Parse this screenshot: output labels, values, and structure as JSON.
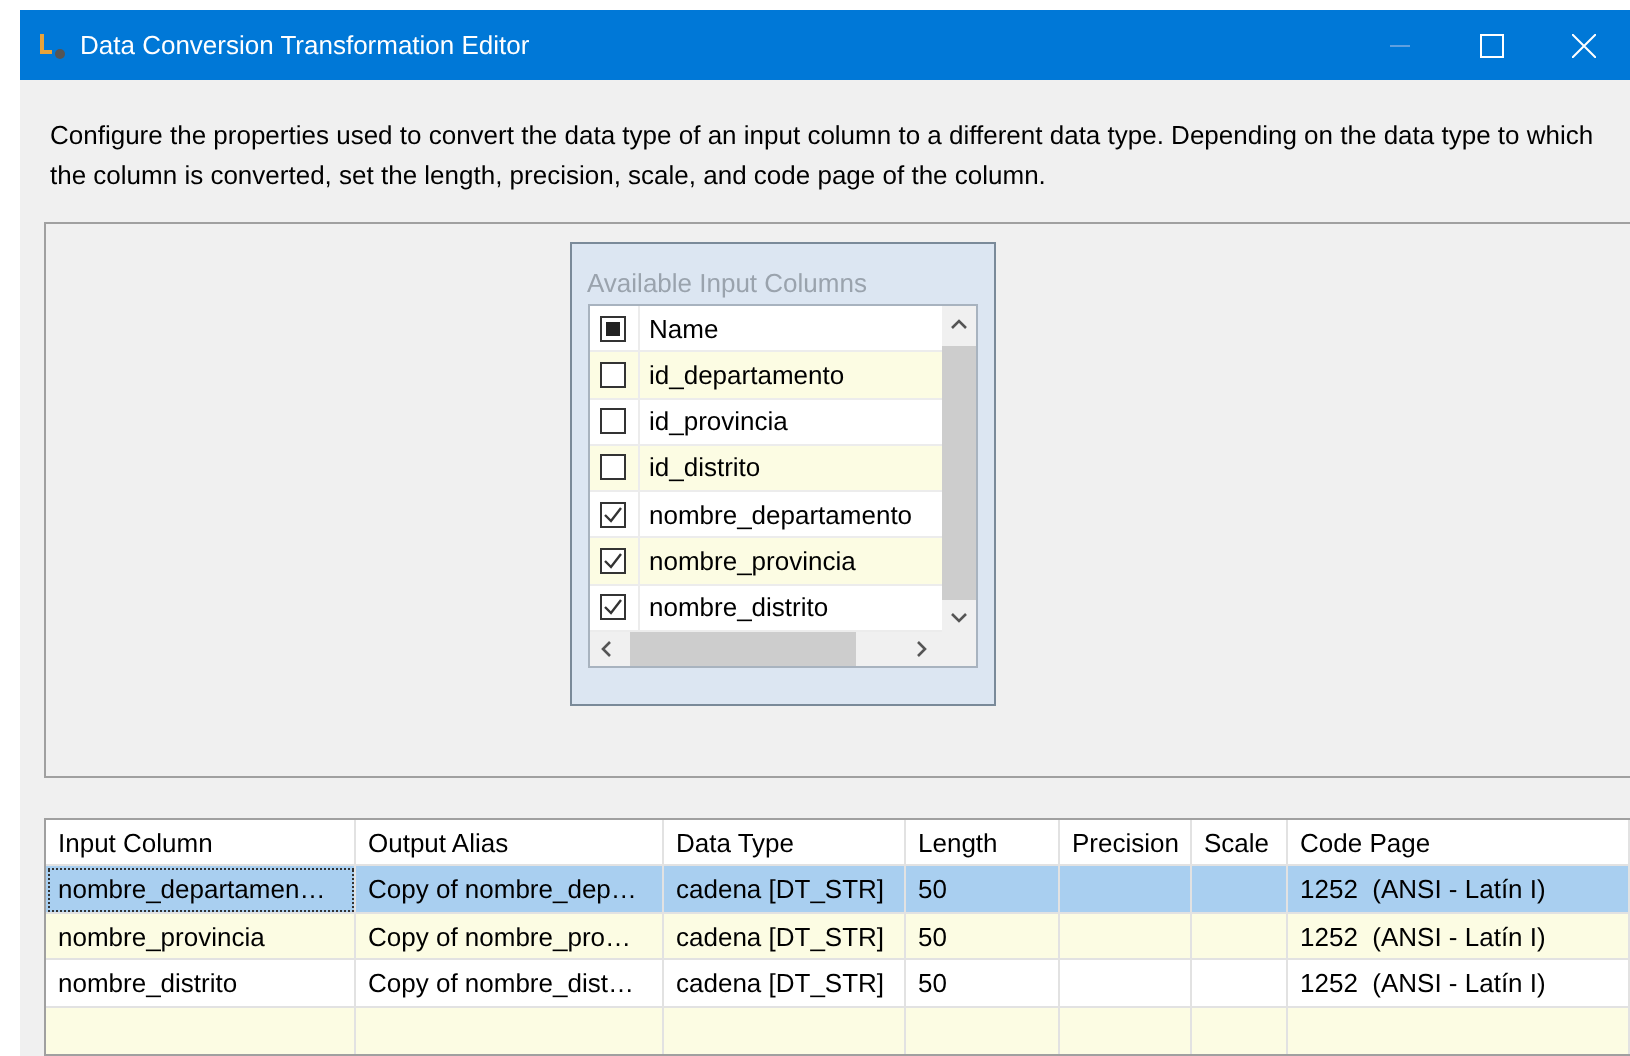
{
  "window": {
    "title": "Data Conversion Transformation Editor"
  },
  "description": "Configure the properties used to convert the data type of an input column to a different data type. Depending on the data type to which the column is converted, set the length, precision, scale, and code page of the column.",
  "available_columns": {
    "title": "Available Input Columns",
    "header": {
      "label": "Name",
      "indeterminate": true
    },
    "items": [
      {
        "name": "id_departamento",
        "checked": false
      },
      {
        "name": "id_provincia",
        "checked": false
      },
      {
        "name": "id_distrito",
        "checked": false
      },
      {
        "name": "nombre_departamento",
        "checked": true
      },
      {
        "name": "nombre_provincia",
        "checked": true
      },
      {
        "name": "nombre_distrito",
        "checked": true
      }
    ]
  },
  "table": {
    "columns": [
      "Input Column",
      "Output Alias",
      "Data Type",
      "Length",
      "Precision",
      "Scale",
      "Code Page"
    ],
    "rows": [
      {
        "selected": true,
        "cells": [
          "nombre_departamen…",
          "Copy of nombre_dep…",
          "cadena [DT_STR]",
          "50",
          "",
          "",
          "1252  (ANSI - Latín I)"
        ]
      },
      {
        "selected": false,
        "cells": [
          "nombre_provincia",
          "Copy of nombre_pro…",
          "cadena [DT_STR]",
          "50",
          "",
          "",
          "1252  (ANSI - Latín I)"
        ]
      },
      {
        "selected": false,
        "cells": [
          "nombre_distrito",
          "Copy of nombre_dist…",
          "cadena [DT_STR]",
          "50",
          "",
          "",
          "1252  (ANSI - Latín I)"
        ]
      }
    ]
  }
}
